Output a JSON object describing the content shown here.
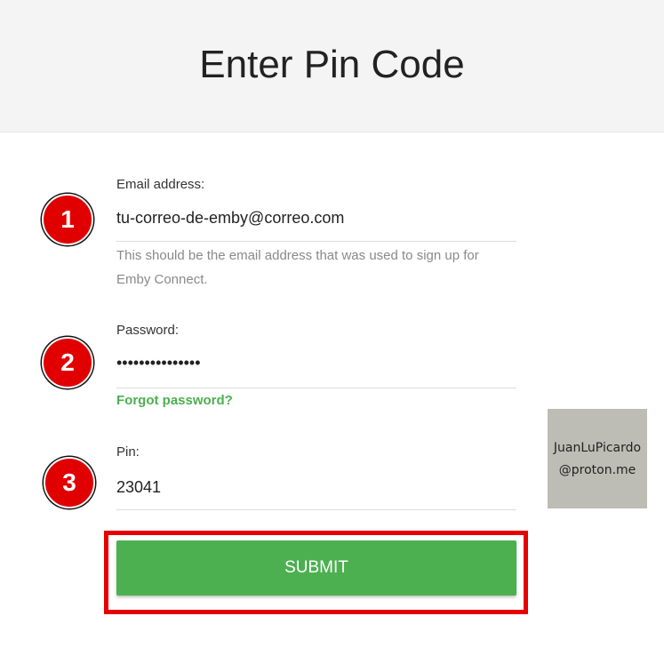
{
  "header": {
    "title": "Enter Pin Code"
  },
  "form": {
    "email": {
      "label": "Email address:",
      "value": "tu-correo-de-emby@correo.com",
      "help": "This should be the email address that was used to sign up for Emby Connect."
    },
    "password": {
      "label": "Password:",
      "value": "•••••••••••••••"
    },
    "forgot_link": "Forgot password?",
    "pin": {
      "label": "Pin:",
      "value": "23041"
    },
    "submit_label": "SUBMIT"
  },
  "annotations": {
    "step1": "1",
    "step2": "2",
    "step3": "3",
    "badge_color": "#e10000",
    "highlight_color": "#e60000"
  },
  "watermark": {
    "line1": "JuanLuPicardo",
    "line2": "@proton.me"
  },
  "colors": {
    "accent": "#4caf50",
    "header_bg": "#f4f4f4"
  }
}
